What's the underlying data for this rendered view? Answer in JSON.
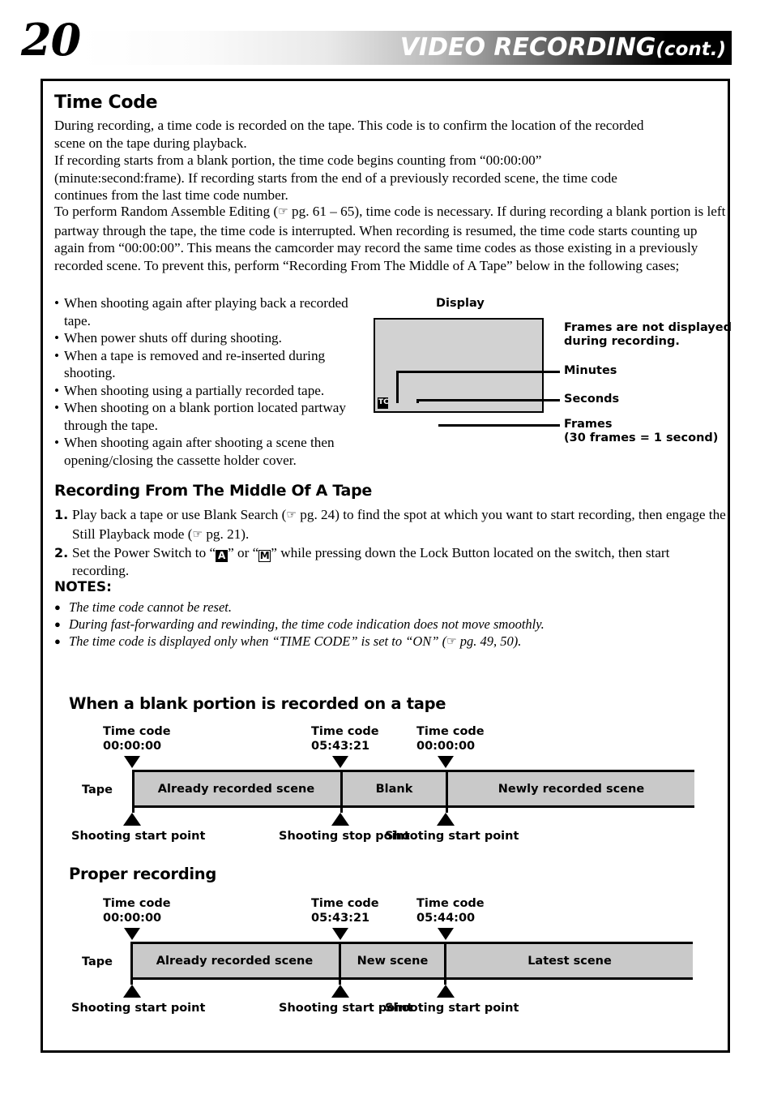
{
  "header": {
    "page_number": "20",
    "title": "VIDEO  RECORDING",
    "title_suffix": "(cont.)"
  },
  "section_time_code": {
    "title": "Time Code",
    "paragraph1_line1": "During recording, a time code is recorded on the tape. This code is to confirm the location of the recorded",
    "paragraph1_line2": "scene on the tape during playback.",
    "paragraph1_line3": "If recording starts from a blank portion, the time code begins counting from “00:00:00”",
    "paragraph1_line4": "(minute:second:frame). If recording starts from the end of a previously recorded scene, the time code",
    "paragraph1_line5": "continues from the last time code number.",
    "paragraph2_part1": "To perform Random Assemble Editing (",
    "paragraph2_part2": " pg. 61 – 65), time code is necessary. If during recording a blank portion is left partway through the tape, the time code is interrupted. When recording is resumed, the time code starts counting up again from “00:00:00”. This means the camcorder may record the same time codes as those existing in a previously recorded scene. To prevent this, perform “Recording From The Middle of A Tape” below in the following cases;",
    "bullets": [
      "When shooting again after playing back a recorded tape.",
      "When power shuts off during shooting.",
      "When a tape is removed and re-inserted during shooting.",
      "When shooting using a partially recorded tape.",
      "When shooting on a blank portion located partway through the tape.",
      "When shooting again after shooting a scene then opening/closing the cassette holder cover."
    ],
    "bullet_marker": "•"
  },
  "display_diagram": {
    "label": "Display",
    "tc_badge": "TC",
    "callouts": {
      "frames_note_line1": "Frames are not displayed",
      "frames_note_line2": "during recording.",
      "minutes": "Minutes",
      "seconds": "Seconds",
      "frames": "Frames",
      "frames_sub": "(30 frames = 1 second)"
    }
  },
  "section_recording_middle": {
    "title": "Recording From The Middle Of A Tape",
    "steps": [
      {
        "num": "1.",
        "text_part1": "Play back a tape or use Blank Search (",
        "text_part2": " pg. 24) to find the spot at which you want to start recording, then engage the Still Playback mode (",
        "text_part3": " pg. 21)."
      },
      {
        "num": "2.",
        "text_part1": "Set the Power Switch to “",
        "mode_a": "A",
        "text_part2": "” or “",
        "mode_m": "M",
        "text_part3": "” while pressing down the Lock Button located on the switch, then start recording."
      }
    ]
  },
  "notes": {
    "title": "NOTES:",
    "marker": "●",
    "items": [
      {
        "full": "The time code cannot be reset."
      },
      {
        "full": "During fast-forwarding and rewinding, the time code indication does not move smoothly."
      },
      {
        "part1": "The time code is displayed only when “TIME CODE” is set to “ON” (",
        "part2": " pg. 49, 50)."
      }
    ]
  },
  "diagram_blank": {
    "title": "When a blank portion is recorded on a tape",
    "tape_word": "Tape",
    "markers_top": [
      {
        "label_line1": "Time code",
        "label_line2": "00:00:00"
      },
      {
        "label_line1": "Time code",
        "label_line2": "05:43:21"
      },
      {
        "label_line1": "Time code",
        "label_line2": "00:00:00"
      }
    ],
    "segments": [
      {
        "label": "Already recorded scene"
      },
      {
        "label": "Blank"
      },
      {
        "label": "Newly recorded scene"
      }
    ],
    "markers_bottom": [
      {
        "label": "Shooting start point"
      },
      {
        "label": "Shooting stop point"
      },
      {
        "label": "Shooting start point"
      }
    ]
  },
  "diagram_proper": {
    "title": "Proper recording",
    "tape_word": "Tape",
    "markers_top": [
      {
        "label_line1": "Time code",
        "label_line2": "00:00:00"
      },
      {
        "label_line1": "Time code",
        "label_line2": "05:43:21"
      },
      {
        "label_line1": "Time code",
        "label_line2": "05:44:00"
      }
    ],
    "segments": [
      {
        "label": "Already recorded scene"
      },
      {
        "label": "New scene"
      },
      {
        "label": "Latest scene"
      }
    ],
    "markers_bottom": [
      {
        "label": "Shooting start point"
      },
      {
        "label": "Shooting start point"
      },
      {
        "label": "Shooting start point"
      }
    ]
  },
  "icons": {
    "pointing_hand": "☞"
  }
}
